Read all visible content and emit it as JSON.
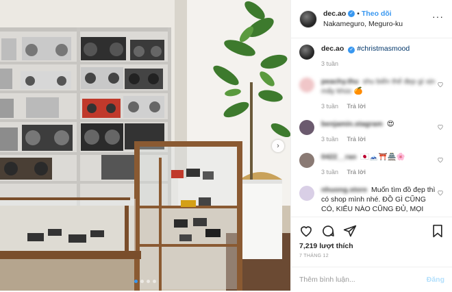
{
  "header": {
    "username": "dec.ao",
    "separator": "•",
    "follow_label": "Theo dõi",
    "location": "Nakameguro, Meguro-ku",
    "more_icon": "more-horizontal-icon"
  },
  "caption": {
    "username": "dec.ao",
    "text": "#christmasmood",
    "time": "3 tuần"
  },
  "comments": [
    {
      "username": "peachy.thu",
      "text": "shu biến thế đẹp gì xịn mấy khúc",
      "emoji": "🍊",
      "time": "3 tuần",
      "reply_label": "Trả lời",
      "avatar_color": "#f0c6c8",
      "blurred": true
    },
    {
      "username": "benjamin.stagram",
      "text": "",
      "emoji": "😍",
      "time": "3 tuần",
      "reply_label": "Trả lời",
      "avatar_color": "#6b5a6e",
      "blurred_user": true
    },
    {
      "username": "0422__rao",
      "text": "",
      "emoji": "🇯🇵🗻⛩️🏯🌸",
      "time": "3 tuần",
      "reply_label": "Trả lời",
      "avatar_color": "#8a7a74",
      "blurred_user": true
    },
    {
      "username": "nhuong.store",
      "text": "Muốn tìm đồ đẹp thì có shop mình nhé. ĐỒ GÌ CŨNG CÓ, KIỂU NÀO CŨNG ĐỦ, MỌI",
      "emoji": "",
      "time": "",
      "reply_label": "",
      "avatar_color": "#d9cfe6",
      "blurred_user": true
    }
  ],
  "actions": {
    "like_icon": "heart-icon",
    "comment_icon": "comment-icon",
    "share_icon": "share-icon",
    "save_icon": "bookmark-icon",
    "likes": "7,219 lượt thích",
    "date": "7 THÁNG 12"
  },
  "add_comment": {
    "placeholder": "Thêm bình luận...",
    "post_label": "Đăng"
  },
  "carousel": {
    "total": 4,
    "active_index": 0,
    "next_icon": "chevron-right-icon"
  },
  "colors": {
    "accent": "#3897f0",
    "muted": "#999999",
    "border": "#efefef"
  }
}
